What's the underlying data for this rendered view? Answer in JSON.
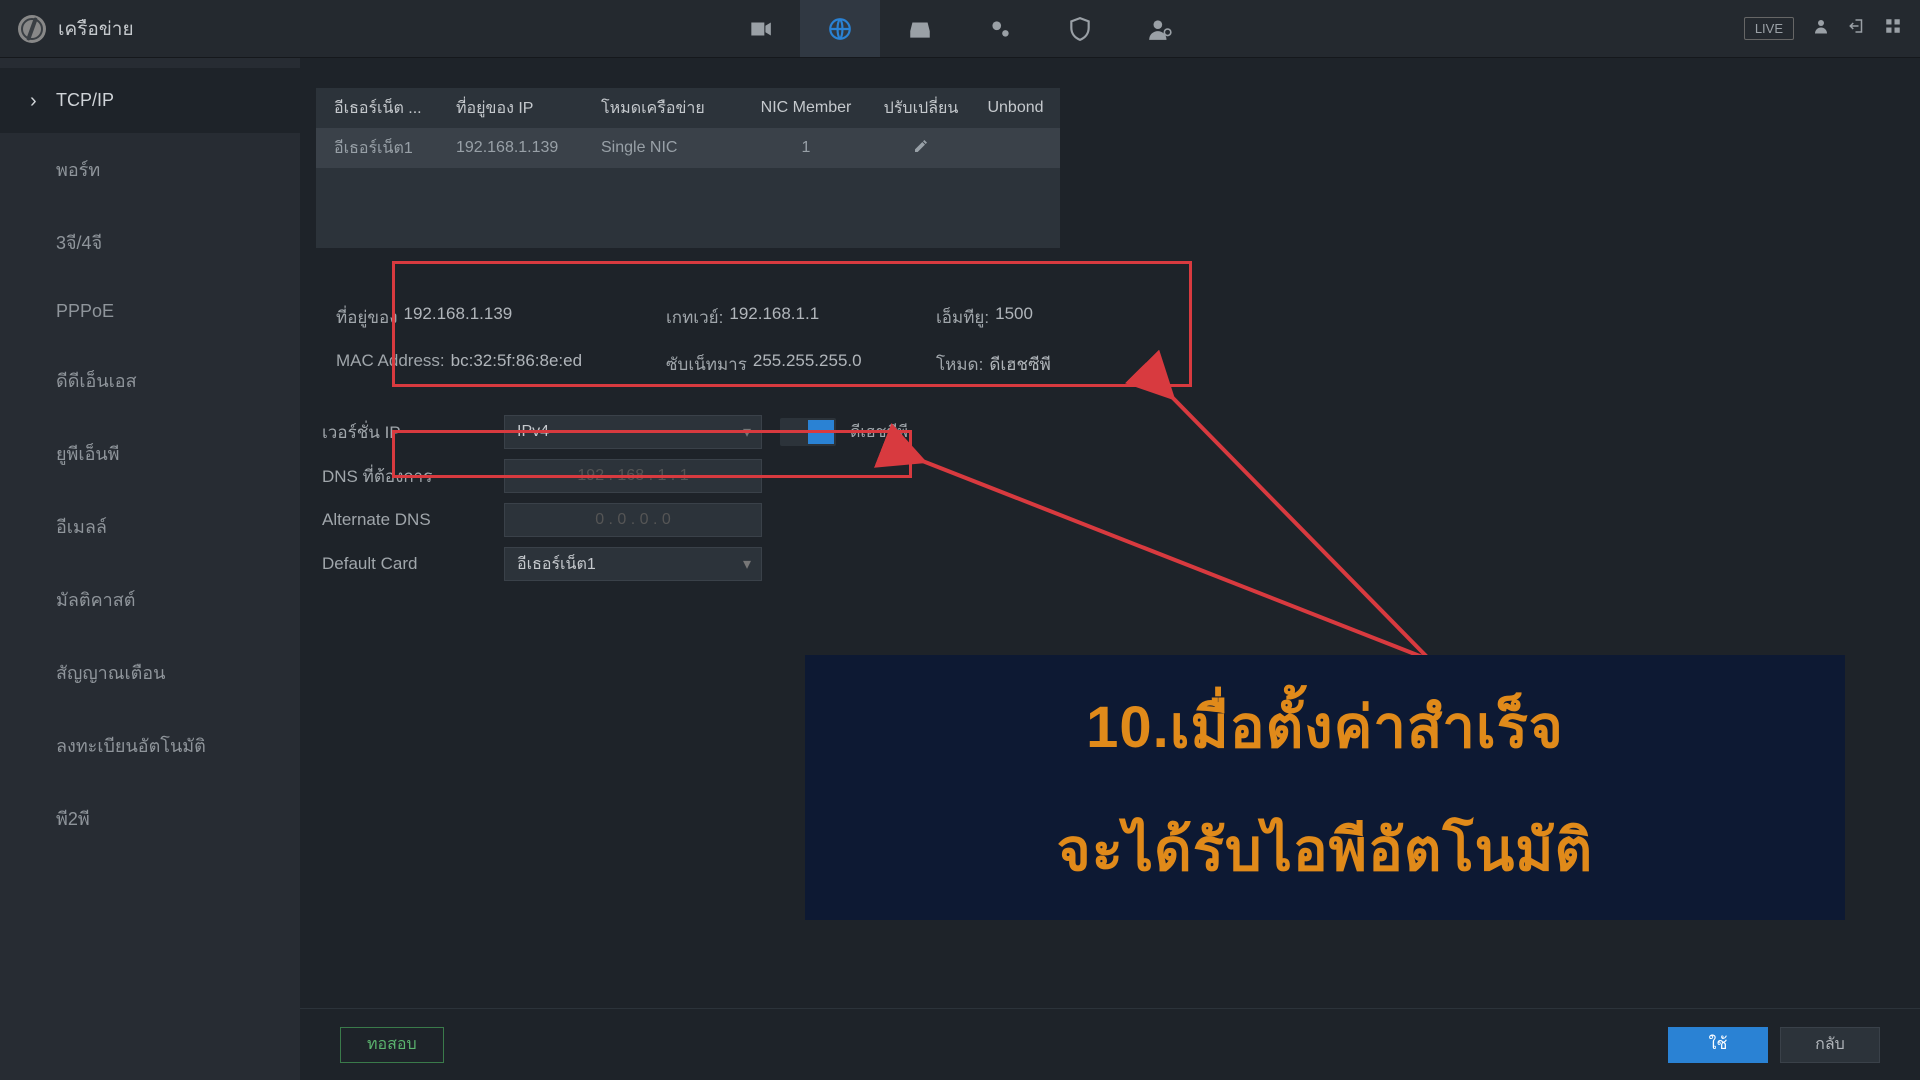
{
  "header": {
    "title": "เครือข่าย",
    "live": "LIVE"
  },
  "sidebar": {
    "items": [
      "TCP/IP",
      "พอร์ท",
      "3จี/4จี",
      "PPPoE",
      "ดีดีเอ็นเอส",
      "ยูพีเอ็นพี",
      "อีเมลล์",
      "มัลติคาสต์",
      "สัญญาณเตือน",
      "ลงทะเบียนอัตโนมัติ",
      "พี2พี"
    ]
  },
  "nic": {
    "headers": {
      "eth": "อีเธอร์เน็ต ...",
      "ip": "ที่อยู่ของ IP",
      "mode": "โหมดเครือข่าย",
      "member": "NIC Member",
      "edit": "ปรับเปลี่ยน",
      "unbond": "Unbond"
    },
    "row": {
      "eth": "อีเธอร์เน็ต1",
      "ip": "192.168.1.139",
      "mode": "Single NIC",
      "member": "1"
    }
  },
  "info": {
    "ip_label": "ที่อยู่ของ",
    "ip": "192.168.1.139",
    "gw_label": "เกทเวย์:",
    "gw": "192.168.1.1",
    "mtu_label": "เอ็มทียู:",
    "mtu": "1500",
    "mac_label": "MAC Address:",
    "mac": "bc:32:5f:86:8e:ed",
    "sub_label": "ซับเน็ทมาร",
    "sub": "255.255.255.0",
    "mode_label": "โหมด:",
    "mode": "ดีเฮชซีพี"
  },
  "form": {
    "ipver_label": "เวอร์ชั่น IP",
    "ipver_value": "IPv4",
    "dhcp_label": "ดีเฮชซีพี",
    "pref_dns_label": "DNS ที่ต้องการ",
    "pref_dns": "192 . 168 . 1 . 1",
    "alt_dns_label": "Alternate DNS",
    "alt_dns": "0 . 0 . 0 . 0",
    "card_label": "Default Card",
    "card_value": "อีเธอร์เน็ต1"
  },
  "callout": {
    "line1": "10.เมื่อตั้งค่าสำเร็จ",
    "line2": "จะได้รับไอพีอัตโนมัติ"
  },
  "footer": {
    "test": "ทอสอบ",
    "apply": "ใช้",
    "back": "กลับ"
  }
}
